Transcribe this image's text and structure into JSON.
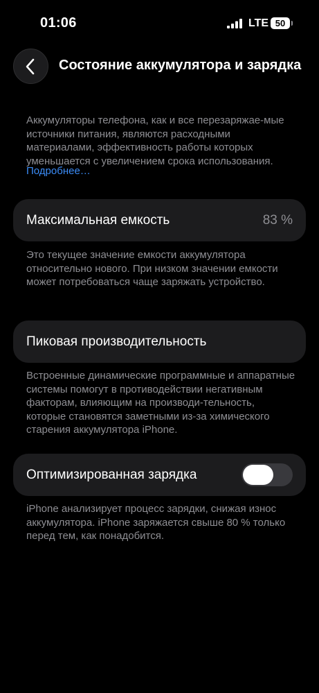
{
  "status_bar": {
    "time": "01:06",
    "network": "LTE",
    "battery": "50",
    "signal_icon": "cellular-signal-icon"
  },
  "header": {
    "back_icon": "chevron-left-icon",
    "title": "Состояние аккумулятора и зарядка"
  },
  "intro": {
    "text": "Аккумуляторы телефона, как и все перезаряжае-мые источники питания, являются расходными материалами, эффективность работы которых уменьшается с увеличением срока использования.",
    "link": "Подробнее…"
  },
  "max_capacity": {
    "label": "Максимальная емкость",
    "value": "83 %",
    "description": "Это текущее значение емкости аккумулятора относительно нового. При низком значении емкости может потребоваться чаще заряжать устройство."
  },
  "peak_performance": {
    "label": "Пиковая производительность",
    "description": "Встроенные динамические программные и аппаратные системы помогут в противодействии негативным факторам, влияющим на производи-тельность, которые становятся заметными из-за химического старения аккумулятора iPhone."
  },
  "optimized_charging": {
    "label": "Оптимизированная зарядка",
    "enabled": false,
    "description": "iPhone анализирует процесс зарядки, снижая износ аккумулятора. iPhone заряжается свыше 80 % только перед тем, как понадобится."
  },
  "colors": {
    "background": "#000000",
    "card": "#1c1c1e",
    "secondary_text": "#8e8e93",
    "link": "#3b8cf7",
    "toggle_off": "#39393d"
  }
}
